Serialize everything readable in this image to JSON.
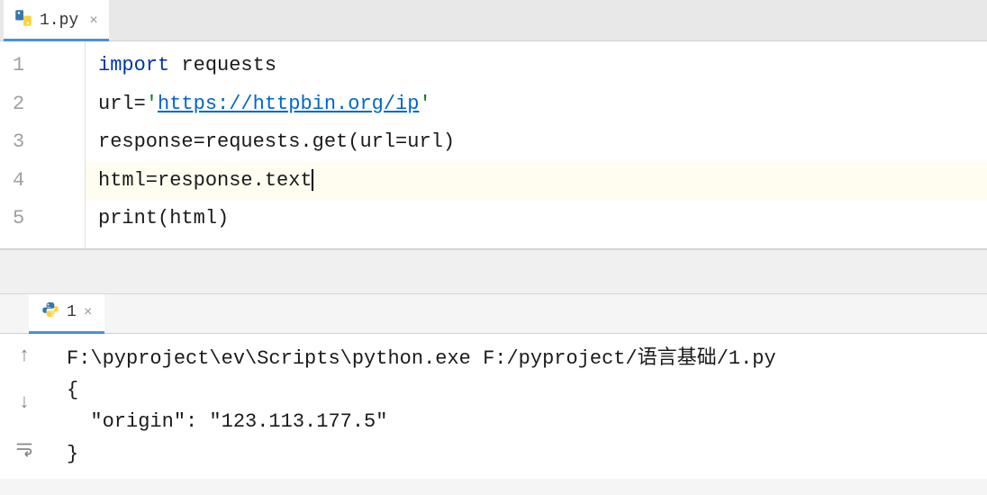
{
  "editor": {
    "tab": {
      "filename": "1.py",
      "close": "×"
    },
    "lines": [
      {
        "num": "1",
        "tokens": [
          {
            "cls": "kw",
            "t": "import"
          },
          {
            "cls": "txt",
            "t": " requests"
          }
        ]
      },
      {
        "num": "2",
        "tokens": [
          {
            "cls": "txt",
            "t": "url="
          },
          {
            "cls": "str",
            "t": "'"
          },
          {
            "cls": "url-link",
            "t": "https://httpbin.org/ip"
          },
          {
            "cls": "str",
            "t": "'"
          }
        ]
      },
      {
        "num": "3",
        "tokens": [
          {
            "cls": "txt",
            "t": "response=requests.get(url=url)"
          }
        ]
      },
      {
        "num": "4",
        "cursor": true,
        "tokens": [
          {
            "cls": "txt",
            "t": "html=response.text"
          }
        ]
      },
      {
        "num": "5",
        "tokens": [
          {
            "cls": "txt",
            "t": "print(html)"
          }
        ]
      }
    ]
  },
  "console": {
    "tab": {
      "name": "1",
      "close": "×"
    },
    "output": [
      "F:\\pyproject\\ev\\Scripts\\python.exe F:/pyproject/语言基础/1.py",
      "{",
      "  \"origin\": \"123.113.177.5\"",
      "}"
    ],
    "tool_icons": {
      "up": "↑",
      "down": "↓",
      "wrap": "↲"
    }
  }
}
